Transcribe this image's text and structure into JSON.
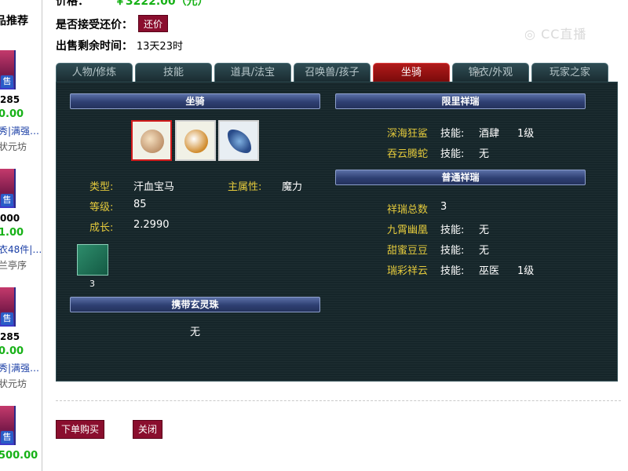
{
  "sidebar": {
    "title": "品推荐",
    "cards": [
      {
        "sell_badge": "售",
        "line1": "285",
        "price": "0.00",
        "desc": "秀|满强…",
        "seller": "状元坊"
      },
      {
        "sell_badge": "售",
        "line1": "000",
        "price": "1.00",
        "desc": "衣48件|…",
        "seller": "兰亭序"
      },
      {
        "sell_badge": "售",
        "line1": "285",
        "price": "0.00",
        "desc": "秀|满强…",
        "seller": "状元坊"
      },
      {
        "sell_badge": "售",
        "line1": "",
        "price": "500.00",
        "desc": "",
        "seller": ""
      }
    ]
  },
  "info": {
    "price_label": "价格：",
    "price_value": "￥3222.00（元）",
    "haggle_label": "是否接受还价：",
    "haggle_button": "还价",
    "remain_label": "出售剩余时间：",
    "remain_value": "13天23时"
  },
  "watermark": "CC直播",
  "tabs": [
    {
      "label": "人物/修炼",
      "active": false
    },
    {
      "label": "技能",
      "active": false
    },
    {
      "label": "道具/法宝",
      "active": false
    },
    {
      "label": "召唤兽/孩子",
      "active": false
    },
    {
      "label": "坐骑",
      "active": true
    },
    {
      "label": "锦衣/外观",
      "active": false
    },
    {
      "label": "玩家之家",
      "active": false
    }
  ],
  "mount_section": {
    "header": "坐骑",
    "icons": [
      "mount-icon-horse",
      "mount-icon-sheep",
      "mount-icon-dragon"
    ],
    "fields": {
      "type_label": "类型:",
      "type_value": "汗血宝马",
      "main_attr_label": "主属性:",
      "main_attr_value": "魔力",
      "level_label": "等级:",
      "level_value": "85",
      "growth_label": "成长:",
      "growth_value": "2.2990"
    },
    "skill_count": "3"
  },
  "orb_section": {
    "header": "携带玄灵珠",
    "value": "无"
  },
  "limited_section": {
    "header": "限里祥瑞",
    "rows": [
      {
        "name": "深海狂鲨",
        "skill_label": "技能:",
        "skill": "酒肆",
        "level": "1级"
      },
      {
        "name": "吞云腾蛇",
        "skill_label": "技能:",
        "skill": "无",
        "level": ""
      }
    ]
  },
  "normal_section": {
    "header": "普通祥瑞",
    "total_label": "祥瑞总数",
    "total_value": "3",
    "rows": [
      {
        "name": "九霄幽凰",
        "skill_label": "技能:",
        "skill": "无",
        "level": ""
      },
      {
        "name": "甜蜜豆豆",
        "skill_label": "技能:",
        "skill": "无",
        "level": ""
      },
      {
        "name": "瑞彩祥云",
        "skill_label": "技能:",
        "skill": "巫医",
        "level": "1级"
      }
    ]
  },
  "actions": {
    "buy": "下单购买",
    "close": "关闭"
  },
  "colors": {
    "accent": "#8a0e2e",
    "price_green": "#17b117",
    "label_gold": "#e3c93c",
    "active_tab": "#b11a1a",
    "panel_bg": "#16262a"
  }
}
